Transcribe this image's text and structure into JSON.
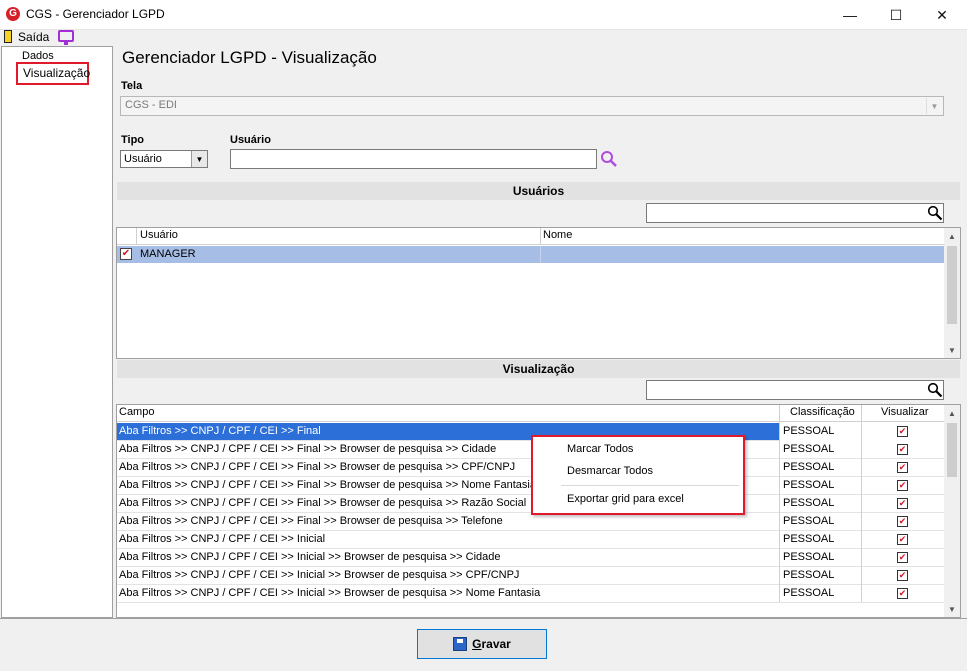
{
  "window": {
    "title": "CGS - Gerenciador LGPD",
    "icon_letter": "G"
  },
  "toolbar": {
    "exit_label": "Saída"
  },
  "tree": {
    "items": [
      "Dados",
      "Visualização"
    ]
  },
  "page": {
    "title": "Gerenciador LGPD - Visualização"
  },
  "form": {
    "tela_label": "Tela",
    "tela_value": "CGS - EDI",
    "tipo_label": "Tipo",
    "tipo_value": "Usuário",
    "usuario_label": "Usuário",
    "usuario_value": ""
  },
  "users": {
    "section_title": "Usuários",
    "filter_value": "",
    "columns": [
      "Usuário",
      "Nome"
    ],
    "rows": [
      {
        "usuario": "MANAGER",
        "nome": "",
        "checked": true
      }
    ]
  },
  "visualizacao": {
    "section_title": "Visualização",
    "filter_value": "",
    "columns": [
      "Campo",
      "Classificação",
      "Visualizar"
    ],
    "rows": [
      {
        "campo": "Aba Filtros >> CNPJ / CPF / CEI >> Final",
        "classificacao": "PESSOAL",
        "visualizar": true
      },
      {
        "campo": "Aba Filtros >> CNPJ / CPF / CEI >> Final >> Browser de pesquisa >> Cidade",
        "classificacao": "PESSOAL",
        "visualizar": true
      },
      {
        "campo": "Aba Filtros >> CNPJ / CPF / CEI >> Final >> Browser de pesquisa >> CPF/CNPJ",
        "classificacao": "PESSOAL",
        "visualizar": true
      },
      {
        "campo": "Aba Filtros >> CNPJ / CPF / CEI >> Final >> Browser de pesquisa >> Nome Fantasia",
        "classificacao": "PESSOAL",
        "visualizar": true
      },
      {
        "campo": "Aba Filtros >> CNPJ / CPF / CEI >> Final >> Browser de pesquisa >> Razão Social",
        "classificacao": "PESSOAL",
        "visualizar": true
      },
      {
        "campo": "Aba Filtros >> CNPJ / CPF / CEI >> Final >> Browser de pesquisa >> Telefone",
        "classificacao": "PESSOAL",
        "visualizar": true
      },
      {
        "campo": "Aba Filtros >> CNPJ / CPF / CEI >> Inicial",
        "classificacao": "PESSOAL",
        "visualizar": true
      },
      {
        "campo": "Aba Filtros >> CNPJ / CPF / CEI >> Inicial >> Browser de pesquisa >> Cidade",
        "classificacao": "PESSOAL",
        "visualizar": true
      },
      {
        "campo": "Aba Filtros >> CNPJ / CPF / CEI >> Inicial >> Browser de pesquisa >> CPF/CNPJ",
        "classificacao": "PESSOAL",
        "visualizar": true
      },
      {
        "campo": "Aba Filtros >> CNPJ / CPF / CEI >> Inicial >> Browser de pesquisa >> Nome Fantasia",
        "classificacao": "PESSOAL",
        "visualizar": true
      }
    ]
  },
  "context_menu": {
    "items": [
      "Marcar Todos",
      "Desmarcar Todos",
      "Exportar grid para excel"
    ]
  },
  "footer": {
    "save_label_first": "G",
    "save_label_rest": "ravar"
  },
  "colors": {
    "selection": "#2d6fd9",
    "highlight_box": "#e0192b",
    "check_mark": "#d0192a"
  }
}
